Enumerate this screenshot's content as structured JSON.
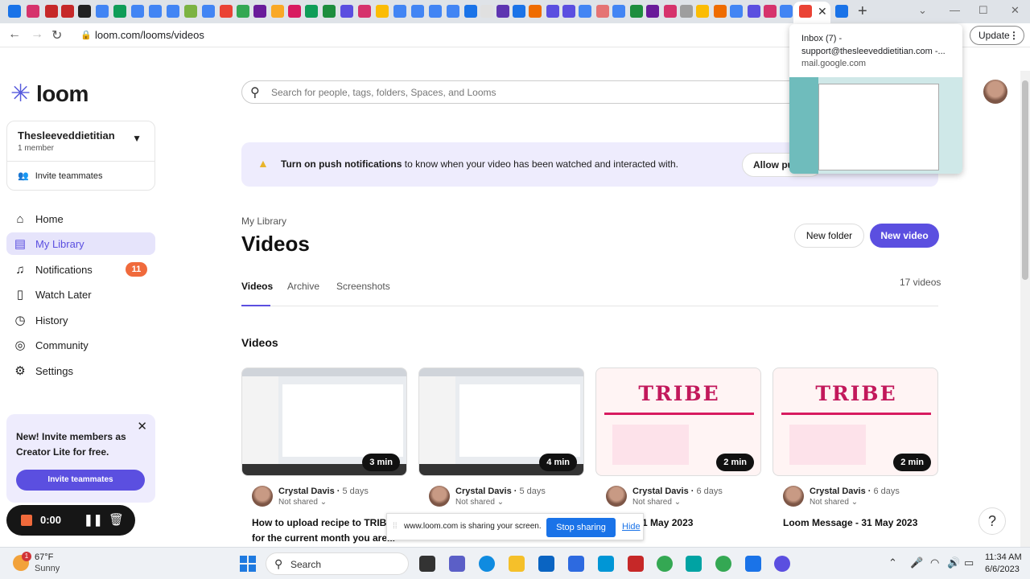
{
  "browser": {
    "url": "loom.com/looms/videos",
    "update_label": "Update",
    "hovercard": {
      "title": "Inbox (7) - support@thesleeveddietitian.com -...",
      "domain": "mail.google.com"
    }
  },
  "brand": {
    "name": "loom"
  },
  "workspace": {
    "name": "Thesleeveddietitian",
    "members": "1 member",
    "invite_label": "Invite teammates"
  },
  "nav": {
    "items": [
      {
        "label": "Home",
        "icon": "home-icon"
      },
      {
        "label": "My Library",
        "icon": "library-icon",
        "active": true
      },
      {
        "label": "Notifications",
        "icon": "bell-icon",
        "badge": "11"
      },
      {
        "label": "Watch Later",
        "icon": "bookmark-icon"
      },
      {
        "label": "History",
        "icon": "clock-icon"
      },
      {
        "label": "Community",
        "icon": "globe-icon"
      },
      {
        "label": "Settings",
        "icon": "gear-icon"
      }
    ]
  },
  "promo": {
    "text": "New! Invite members as Creator Lite for free.",
    "button": "Invite teammates"
  },
  "recorder": {
    "time": "0:00"
  },
  "search": {
    "placeholder": "Search for people, tags, folders, Spaces, and Looms"
  },
  "push_banner": {
    "bold": "Turn on push notifications",
    "text": " to know when your video has been watched and interacted with.",
    "button": "Allow push notifications"
  },
  "library": {
    "breadcrumb": "My Library",
    "title": "Videos",
    "new_folder": "New folder",
    "new_video": "New video",
    "tabs": [
      "Videos",
      "Archive",
      "Screenshots"
    ],
    "count": "17 videos",
    "section_title": "Videos"
  },
  "videos": [
    {
      "duration": "3 min",
      "author": "Crystal Davis",
      "age": "5 days",
      "shared": "Not shared",
      "title": "How to upload recipe to TRIBE for the current month you are...",
      "thumb": "screen"
    },
    {
      "duration": "4 min",
      "author": "Crystal Davis",
      "age": "5 days",
      "shared": "Not shared",
      "title": "",
      "thumb": "screen"
    },
    {
      "duration": "2 min",
      "author": "Crystal Davis",
      "age": "6 days",
      "shared": "Not shared",
      "title": "essage - 31 May 2023",
      "thumb": "tribe"
    },
    {
      "duration": "2 min",
      "author": "Crystal Davis",
      "age": "6 days",
      "shared": "Not shared",
      "title": "Loom Message - 31 May 2023",
      "thumb": "tribe"
    }
  ],
  "thumb_text": {
    "tribe": "TRIBE"
  },
  "share_bar": {
    "text": "www.loom.com is sharing your screen.",
    "stop": "Stop sharing",
    "hide": "Hide"
  },
  "taskbar": {
    "weather_temp": "67°F",
    "weather_cond": "Sunny",
    "weather_badge": "1",
    "search": "Search",
    "time": "11:34 AM",
    "date": "6/6/2023"
  },
  "colors": {
    "accent": "#5b4fe0",
    "badge": "#f06a3c",
    "banner": "#eeecfd"
  }
}
